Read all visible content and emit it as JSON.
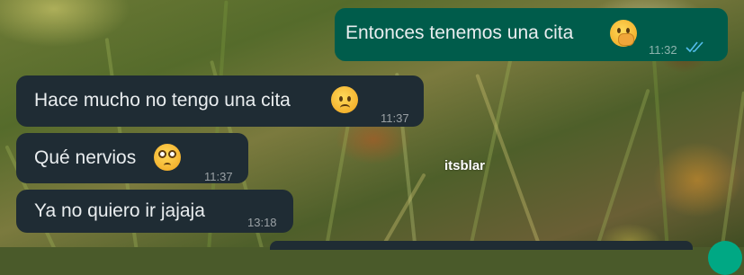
{
  "chat": {
    "messages": [
      {
        "direction": "outgoing",
        "text": "Entonces tenemos una cita",
        "emoji": "face-with-hand-over-mouth",
        "time": "11:32",
        "status": "read"
      },
      {
        "direction": "incoming",
        "text": "Hace mucho no tengo una cita",
        "emoji": "worried-face",
        "time": "11:37"
      },
      {
        "direction": "incoming",
        "text": "Qué nervios",
        "emoji": "pleading-face",
        "time": "11:37"
      },
      {
        "direction": "incoming",
        "text": "Ya no quiero ir jajaja",
        "time": "13:18"
      }
    ]
  },
  "watermark": "itsblar",
  "colors": {
    "incoming_bubble": "#1f2c34",
    "outgoing_bubble": "#005c4b",
    "read_ticks": "#53bdeb",
    "text": "#e9edef"
  }
}
